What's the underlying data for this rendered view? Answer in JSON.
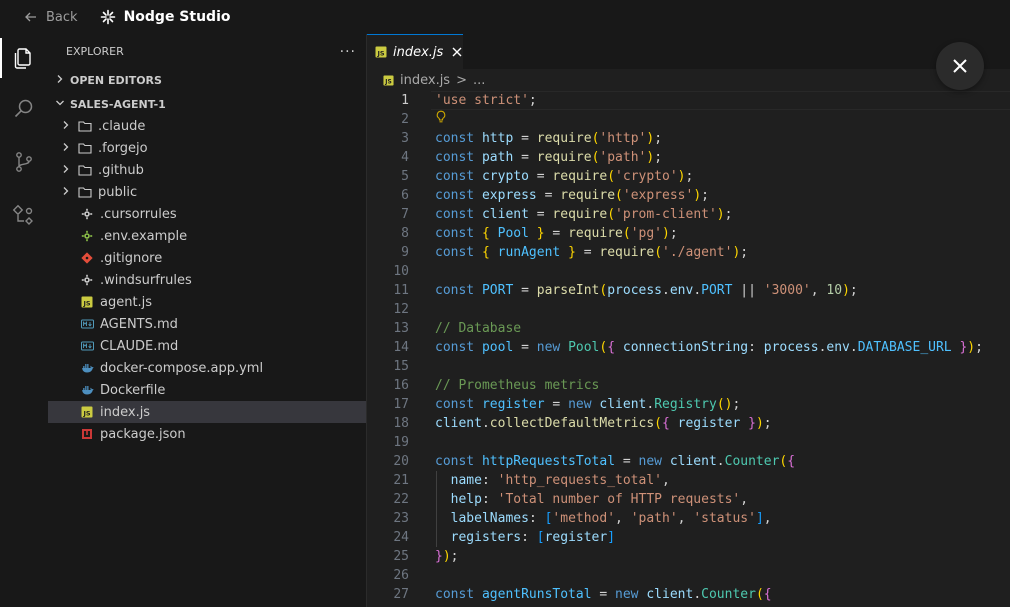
{
  "titlebar": {
    "back_label": "Back",
    "app_name": "Nodge Studio"
  },
  "activity": {
    "icons": [
      "files-icon",
      "search-icon",
      "source-control-icon",
      "nodes-icon"
    ]
  },
  "explorer": {
    "title": "EXPLORER",
    "more": "···",
    "open_editors": "OPEN EDITORS",
    "project": "SALES-AGENT-1",
    "items": [
      {
        "name": ".claude",
        "type": "folder"
      },
      {
        "name": ".forgejo",
        "type": "folder"
      },
      {
        "name": ".github",
        "type": "folder"
      },
      {
        "name": "public",
        "type": "folder"
      },
      {
        "name": ".cursorrules",
        "type": "gear"
      },
      {
        "name": ".env.example",
        "type": "gear-green"
      },
      {
        "name": ".gitignore",
        "type": "git"
      },
      {
        "name": ".windsurfrules",
        "type": "gear"
      },
      {
        "name": "agent.js",
        "type": "js"
      },
      {
        "name": "AGENTS.md",
        "type": "md"
      },
      {
        "name": "CLAUDE.md",
        "type": "md"
      },
      {
        "name": "docker-compose.app.yml",
        "type": "docker"
      },
      {
        "name": "Dockerfile",
        "type": "docker"
      },
      {
        "name": "index.js",
        "type": "js",
        "selected": true
      },
      {
        "name": "package.json",
        "type": "npm"
      }
    ]
  },
  "editor": {
    "tab_label": "index.js",
    "breadcrumb_file": "index.js",
    "breadcrumb_sep": ">",
    "breadcrumb_rest": "...",
    "current_line": 1,
    "lines": [
      {
        "n": "1",
        "tokens": [
          [
            "str",
            "'use strict'"
          ],
          [
            "p",
            ";"
          ]
        ]
      },
      {
        "n": "2",
        "tokens": [],
        "bulb": true
      },
      {
        "n": "3",
        "tokens": [
          [
            "kw",
            "const"
          ],
          [
            "p",
            " "
          ],
          [
            "var",
            "http"
          ],
          [
            "p",
            " = "
          ],
          [
            "fn",
            "require"
          ],
          [
            "br1",
            "("
          ],
          [
            "str",
            "'http'"
          ],
          [
            "br1",
            ")"
          ],
          [
            "p",
            ";"
          ]
        ]
      },
      {
        "n": "4",
        "tokens": [
          [
            "kw",
            "const"
          ],
          [
            "p",
            " "
          ],
          [
            "var",
            "path"
          ],
          [
            "p",
            " = "
          ],
          [
            "fn",
            "require"
          ],
          [
            "br1",
            "("
          ],
          [
            "str",
            "'path'"
          ],
          [
            "br1",
            ")"
          ],
          [
            "p",
            ";"
          ]
        ]
      },
      {
        "n": "5",
        "tokens": [
          [
            "kw",
            "const"
          ],
          [
            "p",
            " "
          ],
          [
            "var",
            "crypto"
          ],
          [
            "p",
            " = "
          ],
          [
            "fn",
            "require"
          ],
          [
            "br1",
            "("
          ],
          [
            "str",
            "'crypto'"
          ],
          [
            "br1",
            ")"
          ],
          [
            "p",
            ";"
          ]
        ]
      },
      {
        "n": "6",
        "tokens": [
          [
            "kw",
            "const"
          ],
          [
            "p",
            " "
          ],
          [
            "var",
            "express"
          ],
          [
            "p",
            " = "
          ],
          [
            "fn",
            "require"
          ],
          [
            "br1",
            "("
          ],
          [
            "str",
            "'express'"
          ],
          [
            "br1",
            ")"
          ],
          [
            "p",
            ";"
          ]
        ]
      },
      {
        "n": "7",
        "tokens": [
          [
            "kw",
            "const"
          ],
          [
            "p",
            " "
          ],
          [
            "var",
            "client"
          ],
          [
            "p",
            " = "
          ],
          [
            "fn",
            "require"
          ],
          [
            "br1",
            "("
          ],
          [
            "str",
            "'prom-client'"
          ],
          [
            "br1",
            ")"
          ],
          [
            "p",
            ";"
          ]
        ]
      },
      {
        "n": "8",
        "tokens": [
          [
            "kw",
            "const"
          ],
          [
            "p",
            " "
          ],
          [
            "br1",
            "{"
          ],
          [
            "p",
            " "
          ],
          [
            "const",
            "Pool"
          ],
          [
            "p",
            " "
          ],
          [
            "br1",
            "}"
          ],
          [
            "p",
            " = "
          ],
          [
            "fn",
            "require"
          ],
          [
            "br1",
            "("
          ],
          [
            "str",
            "'pg'"
          ],
          [
            "br1",
            ")"
          ],
          [
            "p",
            ";"
          ]
        ]
      },
      {
        "n": "9",
        "tokens": [
          [
            "kw",
            "const"
          ],
          [
            "p",
            " "
          ],
          [
            "br1",
            "{"
          ],
          [
            "p",
            " "
          ],
          [
            "const",
            "runAgent"
          ],
          [
            "p",
            " "
          ],
          [
            "br1",
            "}"
          ],
          [
            "p",
            " = "
          ],
          [
            "fn",
            "require"
          ],
          [
            "br1",
            "("
          ],
          [
            "str",
            "'./agent'"
          ],
          [
            "br1",
            ")"
          ],
          [
            "p",
            ";"
          ]
        ]
      },
      {
        "n": "10",
        "tokens": []
      },
      {
        "n": "11",
        "tokens": [
          [
            "kw",
            "const"
          ],
          [
            "p",
            " "
          ],
          [
            "const",
            "PORT"
          ],
          [
            "p",
            " = "
          ],
          [
            "fn",
            "parseInt"
          ],
          [
            "br1",
            "("
          ],
          [
            "var",
            "process"
          ],
          [
            "p",
            "."
          ],
          [
            "var",
            "env"
          ],
          [
            "p",
            "."
          ],
          [
            "const",
            "PORT"
          ],
          [
            "p",
            " || "
          ],
          [
            "str",
            "'3000'"
          ],
          [
            "p",
            ", "
          ],
          [
            "num",
            "10"
          ],
          [
            "br1",
            ")"
          ],
          [
            "p",
            ";"
          ]
        ]
      },
      {
        "n": "12",
        "tokens": []
      },
      {
        "n": "13",
        "tokens": [
          [
            "cmt",
            "// Database"
          ]
        ]
      },
      {
        "n": "14",
        "tokens": [
          [
            "kw",
            "const"
          ],
          [
            "p",
            " "
          ],
          [
            "const",
            "pool"
          ],
          [
            "p",
            " = "
          ],
          [
            "kw",
            "new"
          ],
          [
            "p",
            " "
          ],
          [
            "cls",
            "Pool"
          ],
          [
            "br1",
            "("
          ],
          [
            "br2",
            "{"
          ],
          [
            "p",
            " "
          ],
          [
            "var",
            "connectionString"
          ],
          [
            "p",
            ": "
          ],
          [
            "var",
            "process"
          ],
          [
            "p",
            "."
          ],
          [
            "var",
            "env"
          ],
          [
            "p",
            "."
          ],
          [
            "const",
            "DATABASE_URL"
          ],
          [
            "p",
            " "
          ],
          [
            "br2",
            "}"
          ],
          [
            "br1",
            ")"
          ],
          [
            "p",
            ";"
          ]
        ]
      },
      {
        "n": "15",
        "tokens": []
      },
      {
        "n": "16",
        "tokens": [
          [
            "cmt",
            "// Prometheus metrics"
          ]
        ]
      },
      {
        "n": "17",
        "tokens": [
          [
            "kw",
            "const"
          ],
          [
            "p",
            " "
          ],
          [
            "const",
            "register"
          ],
          [
            "p",
            " = "
          ],
          [
            "kw",
            "new"
          ],
          [
            "p",
            " "
          ],
          [
            "var",
            "client"
          ],
          [
            "p",
            "."
          ],
          [
            "cls",
            "Registry"
          ],
          [
            "br1",
            "("
          ],
          [
            "br1",
            ")"
          ],
          [
            "p",
            ";"
          ]
        ]
      },
      {
        "n": "18",
        "tokens": [
          [
            "var",
            "client"
          ],
          [
            "p",
            "."
          ],
          [
            "fn",
            "collectDefaultMetrics"
          ],
          [
            "br1",
            "("
          ],
          [
            "br2",
            "{"
          ],
          [
            "p",
            " "
          ],
          [
            "var",
            "register"
          ],
          [
            "p",
            " "
          ],
          [
            "br2",
            "}"
          ],
          [
            "br1",
            ")"
          ],
          [
            "p",
            ";"
          ]
        ]
      },
      {
        "n": "19",
        "tokens": []
      },
      {
        "n": "20",
        "tokens": [
          [
            "kw",
            "const"
          ],
          [
            "p",
            " "
          ],
          [
            "const",
            "httpRequestsTotal"
          ],
          [
            "p",
            " = "
          ],
          [
            "kw",
            "new"
          ],
          [
            "p",
            " "
          ],
          [
            "var",
            "client"
          ],
          [
            "p",
            "."
          ],
          [
            "cls",
            "Counter"
          ],
          [
            "br1",
            "("
          ],
          [
            "br2",
            "{"
          ]
        ]
      },
      {
        "n": "21",
        "tokens": [
          [
            "p",
            "  "
          ],
          [
            "var",
            "name"
          ],
          [
            "p",
            ": "
          ],
          [
            "str",
            "'http_requests_total'"
          ],
          [
            "p",
            ","
          ]
        ]
      },
      {
        "n": "22",
        "tokens": [
          [
            "p",
            "  "
          ],
          [
            "var",
            "help"
          ],
          [
            "p",
            ": "
          ],
          [
            "str",
            "'Total number of HTTP requests'"
          ],
          [
            "p",
            ","
          ]
        ]
      },
      {
        "n": "23",
        "tokens": [
          [
            "p",
            "  "
          ],
          [
            "var",
            "labelNames"
          ],
          [
            "p",
            ": "
          ],
          [
            "br3",
            "["
          ],
          [
            "str",
            "'method'"
          ],
          [
            "p",
            ", "
          ],
          [
            "str",
            "'path'"
          ],
          [
            "p",
            ", "
          ],
          [
            "str",
            "'status'"
          ],
          [
            "br3",
            "]"
          ],
          [
            "p",
            ","
          ]
        ]
      },
      {
        "n": "24",
        "tokens": [
          [
            "p",
            "  "
          ],
          [
            "var",
            "registers"
          ],
          [
            "p",
            ": "
          ],
          [
            "br3",
            "["
          ],
          [
            "var",
            "register"
          ],
          [
            "br3",
            "]"
          ]
        ]
      },
      {
        "n": "25",
        "tokens": [
          [
            "br2",
            "}"
          ],
          [
            "br1",
            ")"
          ],
          [
            "p",
            ";"
          ]
        ]
      },
      {
        "n": "26",
        "tokens": []
      },
      {
        "n": "27",
        "tokens": [
          [
            "kw",
            "const"
          ],
          [
            "p",
            " "
          ],
          [
            "const",
            "agentRunsTotal"
          ],
          [
            "p",
            " = "
          ],
          [
            "kw",
            "new"
          ],
          [
            "p",
            " "
          ],
          [
            "var",
            "client"
          ],
          [
            "p",
            "."
          ],
          [
            "cls",
            "Counter"
          ],
          [
            "br1",
            "("
          ],
          [
            "br2",
            "{"
          ]
        ]
      }
    ]
  },
  "colors": {
    "accent": "#0078d4",
    "js_icon": "#cbcb41",
    "md_icon": "#519aba",
    "docker_icon": "#4d8fbf",
    "git_icon": "#e44d3a",
    "npm_icon": "#cb3837",
    "env_icon": "#8dc149"
  }
}
